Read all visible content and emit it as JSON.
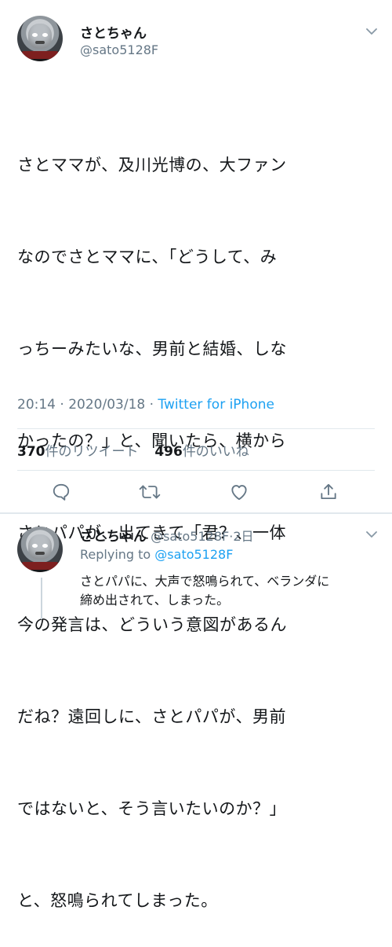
{
  "tweet": {
    "author_name": "さとちゃん",
    "author_handle": "@sato5128F",
    "lines": [
      "さとママが、及川光博の、大ファン",
      "なのでさとママに、「どうして、み",
      "っちーみたいな、男前と結婚、しな",
      "かったの？」と、聞いたら、横から",
      "さとパパが、出てきて「君？、一体",
      "今の発言は、どういう意図があるん",
      "だね？遠回しに、さとパパが、男前",
      "ではないと、そう言いたいのか？」",
      "と、怒鳴られてしまった。"
    ],
    "time": "20:14",
    "separator": "·",
    "date": "2020/03/18",
    "source": "Twitter for iPhone",
    "retweet_count": "370",
    "retweet_label": "件のリツイート",
    "like_count": "496",
    "like_label": "件のいいね"
  },
  "reply": {
    "author_name": "さとちゃん",
    "author_handle": "@sato5128F",
    "separator": "·",
    "time_ago": "2日",
    "replying_to_label": "Replying to",
    "replying_to_handle": "@sato5128F",
    "lines": [
      "さとパパに、大声で怒鳴られて、ベランダに",
      "締め出されて、しまった。"
    ]
  },
  "icons": {
    "reply": "reply-icon",
    "retweet": "retweet-icon",
    "like": "heart-icon",
    "share": "share-icon",
    "more": "chevron-down-icon"
  },
  "colors": {
    "text": "#14171a",
    "secondary": "#657786",
    "link": "#1da1f2",
    "divider": "#e1e8ed"
  }
}
